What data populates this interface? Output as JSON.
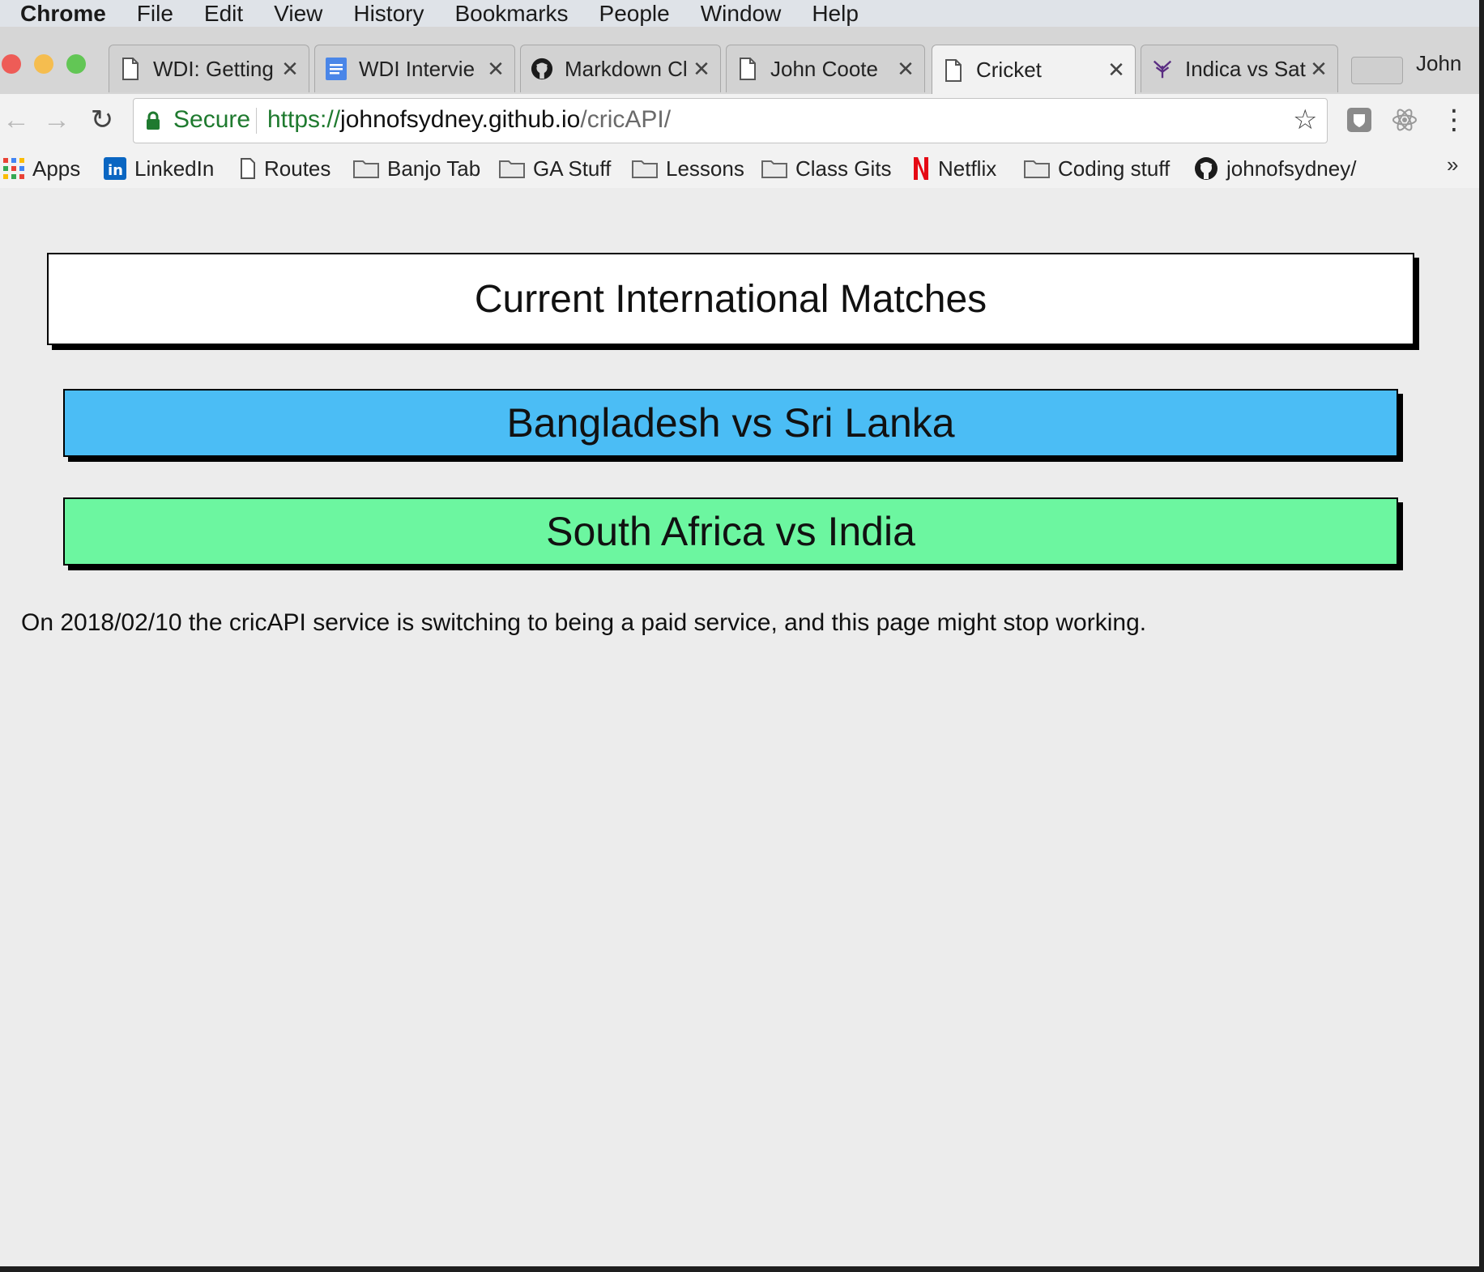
{
  "menubar": {
    "app": "Chrome",
    "items": [
      "File",
      "Edit",
      "View",
      "History",
      "Bookmarks",
      "People",
      "Window",
      "Help"
    ]
  },
  "tabs": [
    {
      "label": "WDI: Getting",
      "icon": "page-icon"
    },
    {
      "label": "WDI Intervie",
      "icon": "docs-icon"
    },
    {
      "label": "Markdown Cl",
      "icon": "github-icon"
    },
    {
      "label": "John Coote",
      "icon": "page-icon"
    },
    {
      "label": "Cricket",
      "icon": "page-icon",
      "active": true
    },
    {
      "label": "Indica vs Sat",
      "icon": "leaf-icon"
    }
  ],
  "profile": "John",
  "omnibox": {
    "secure_label": "Secure",
    "url_scheme": "https://",
    "url_host": "johnofsydney.github.io",
    "url_path": "/cricAPI/"
  },
  "bookmarks": [
    {
      "label": "Apps",
      "icon": "apps-grid-icon"
    },
    {
      "label": "LinkedIn",
      "icon": "linkedin-icon"
    },
    {
      "label": "Routes",
      "icon": "page-icon"
    },
    {
      "label": "Banjo Tab",
      "icon": "folder-icon"
    },
    {
      "label": "GA Stuff",
      "icon": "folder-icon"
    },
    {
      "label": "Lessons",
      "icon": "folder-icon"
    },
    {
      "label": "Class Gits",
      "icon": "folder-icon"
    },
    {
      "label": "Netflix",
      "icon": "netflix-icon"
    },
    {
      "label": "Coding stuff",
      "icon": "folder-icon"
    },
    {
      "label": "johnofsydney/",
      "icon": "github-icon"
    }
  ],
  "page": {
    "heading": "Current International Matches",
    "matches": [
      {
        "label": "Bangladesh vs Sri Lanka",
        "color": "#4bbdf5"
      },
      {
        "label": "South Africa vs India",
        "color": "#6cf6a0"
      }
    ],
    "notice": "On 2018/02/10 the cricAPI service is switching to being a paid service, and this page might stop working."
  },
  "colors": {
    "secure_green": "#1f7a2f",
    "page_background": "#ececec"
  }
}
